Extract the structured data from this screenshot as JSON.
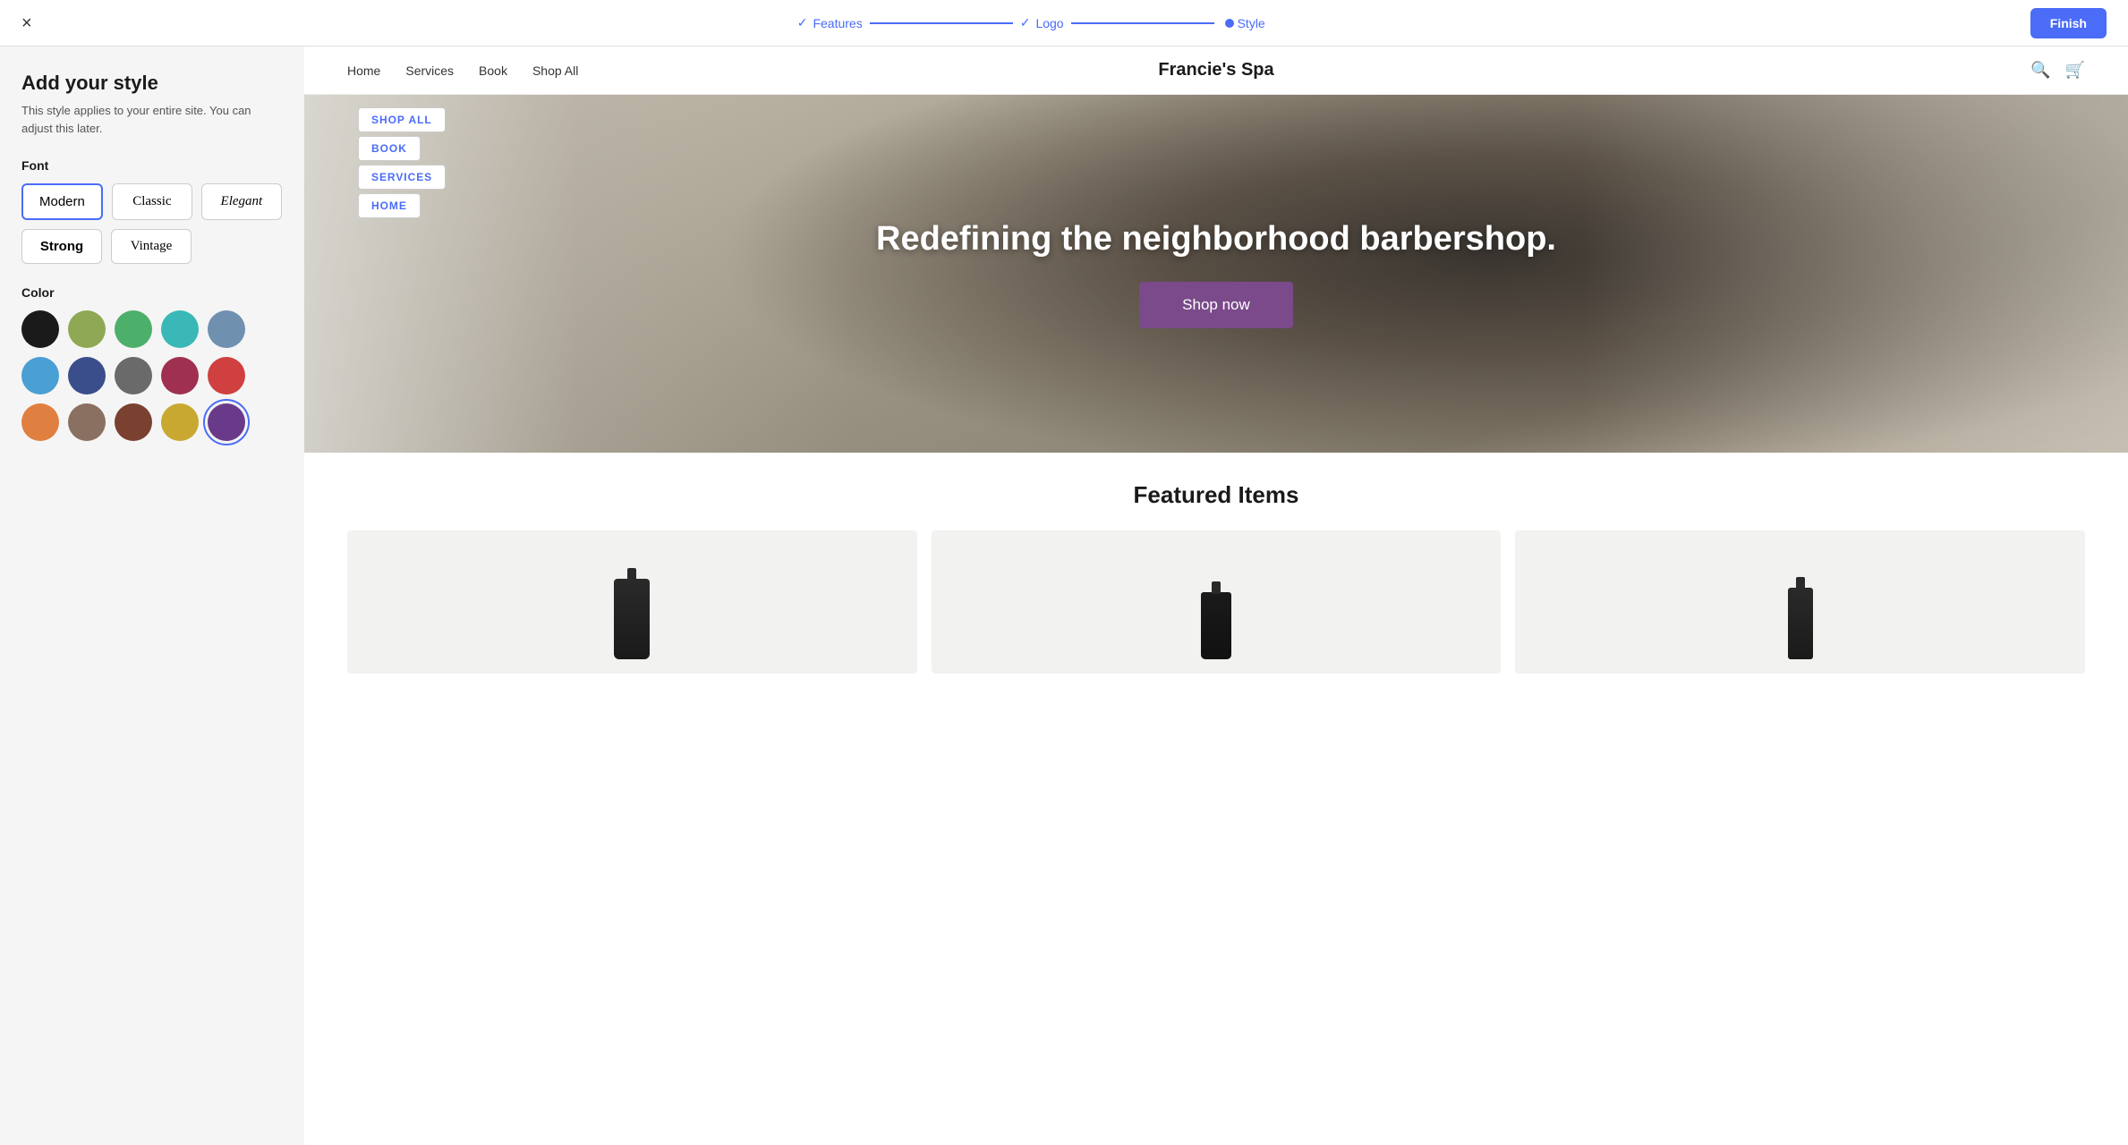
{
  "topbar": {
    "close_label": "×",
    "finish_label": "Finish",
    "steps": [
      {
        "id": "features",
        "label": "Features",
        "status": "done"
      },
      {
        "id": "logo",
        "label": "Logo",
        "status": "done"
      },
      {
        "id": "style",
        "label": "Style",
        "status": "active"
      }
    ]
  },
  "left_panel": {
    "title": "Add your style",
    "description": "This style applies to your entire site. You can adjust this later.",
    "font_section_label": "Font",
    "font_options": [
      {
        "id": "modern",
        "label": "Modern",
        "active": true
      },
      {
        "id": "classic",
        "label": "Classic",
        "active": false
      },
      {
        "id": "elegant",
        "label": "Elegant",
        "active": false
      },
      {
        "id": "strong",
        "label": "Strong",
        "active": false
      },
      {
        "id": "vintage",
        "label": "Vintage",
        "active": false
      }
    ],
    "color_section_label": "Color",
    "colors": [
      {
        "id": "black",
        "hex": "#1a1a1a",
        "selected": false
      },
      {
        "id": "olive-green",
        "hex": "#8fa854",
        "selected": false
      },
      {
        "id": "green",
        "hex": "#4caf6a",
        "selected": false
      },
      {
        "id": "teal",
        "hex": "#3ab8b8",
        "selected": false
      },
      {
        "id": "blue-gray",
        "hex": "#7090b0",
        "selected": false
      },
      {
        "id": "light-blue",
        "hex": "#4a9fd4",
        "selected": false
      },
      {
        "id": "navy",
        "hex": "#3a4e8c",
        "selected": false
      },
      {
        "id": "gray",
        "hex": "#6a6a6a",
        "selected": false
      },
      {
        "id": "dark-red",
        "hex": "#a03050",
        "selected": false
      },
      {
        "id": "red",
        "hex": "#d04040",
        "selected": false
      },
      {
        "id": "orange",
        "hex": "#e08040",
        "selected": false
      },
      {
        "id": "taupe",
        "hex": "#8a7060",
        "selected": false
      },
      {
        "id": "brown",
        "hex": "#7a4030",
        "selected": false
      },
      {
        "id": "gold",
        "hex": "#c8a830",
        "selected": false
      },
      {
        "id": "purple",
        "hex": "#6a3a8a",
        "selected": true
      }
    ]
  },
  "nav_dropdowns": [
    {
      "label": "SHOP ALL"
    },
    {
      "label": "BOOK"
    },
    {
      "label": "SERVICES"
    },
    {
      "label": "HOME"
    }
  ],
  "site_nav": {
    "logo": "Francie's Spa",
    "links": [
      "Home",
      "Services",
      "Book",
      "Shop All"
    ],
    "search_icon": "🔍",
    "cart_icon": "🛒"
  },
  "hero": {
    "title": "Redefining the neighborhood barbershop.",
    "cta_label": "Shop now"
  },
  "featured": {
    "title": "Featured Items",
    "products": [
      {
        "id": "product-1"
      },
      {
        "id": "product-2"
      },
      {
        "id": "product-3"
      }
    ]
  }
}
